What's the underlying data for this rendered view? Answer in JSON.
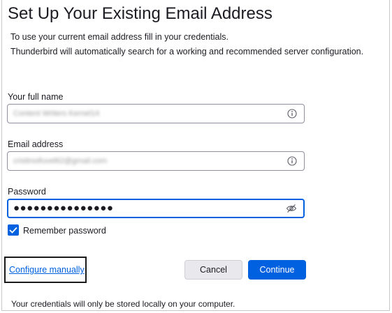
{
  "title": "Set Up Your Existing Email Address",
  "description": {
    "line1": "To use your current email address fill in your credentials.",
    "line2": "Thunderbird will automatically search for a working and recommended server configuration."
  },
  "fields": {
    "full_name": {
      "label": "Your full name",
      "value": "Content Writers Kernel14",
      "icon": "info-icon"
    },
    "email": {
      "label": "Email address",
      "value": "cristinoifuvel62@gmail.com",
      "icon": "info-icon"
    },
    "password": {
      "label": "Password",
      "value": "●●●●●●●●●●●●●●●",
      "icon": "eye-slash-icon"
    }
  },
  "remember": {
    "label": "Remember password",
    "checked": true
  },
  "configure_manually": "Configure manually",
  "buttons": {
    "cancel": "Cancel",
    "continue": "Continue"
  },
  "footer": "Your credentials will only be stored locally on your computer.",
  "colors": {
    "accent": "#0061e0",
    "secondary_button": "#e9e9ed",
    "text": "#1c1b22"
  }
}
